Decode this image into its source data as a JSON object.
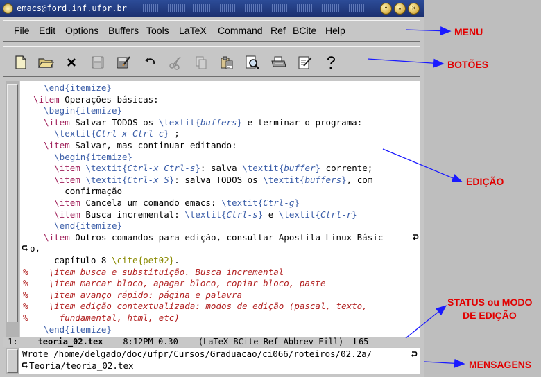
{
  "window": {
    "title": "emacs@ford.inf.ufpr.br",
    "menu": [
      "File",
      "Edit",
      "Options",
      "Buffers",
      "Tools",
      "LaTeX",
      "Command",
      "Ref",
      "BCite",
      "Help"
    ],
    "toolbar_icons": [
      "new-file-icon",
      "open-folder-icon",
      "close-x-icon",
      "save-disk-icon",
      "save-as-icon",
      "undo-icon",
      "cut-scissors-icon",
      "copy-icon",
      "paste-icon",
      "search-icon",
      "print-icon",
      "spell-check-icon",
      "help-question-icon"
    ]
  },
  "editor": {
    "lines": [
      {
        "indent": "    ",
        "tokens": [
          [
            "\\end{itemize}",
            "fn"
          ]
        ]
      },
      {
        "indent": "  ",
        "tokens": [
          [
            "\\item",
            "kw"
          ],
          [
            " Operações básicas:",
            ""
          ]
        ]
      },
      {
        "indent": "    ",
        "tokens": [
          [
            "\\begin{itemize}",
            "fn"
          ]
        ]
      },
      {
        "indent": "    ",
        "tokens": [
          [
            "\\item",
            "kw"
          ],
          [
            " Salvar TODOS os ",
            ""
          ],
          [
            "\\textit{",
            "fn"
          ],
          [
            "buffers",
            "arg"
          ],
          [
            "}",
            "fn"
          ],
          [
            " e terminar o programa:",
            ""
          ]
        ]
      },
      {
        "indent": "      ",
        "tokens": [
          [
            "\\textit{",
            "fn"
          ],
          [
            "Ctrl-x Ctrl-c",
            "arg"
          ],
          [
            "}",
            "fn"
          ],
          [
            " ;",
            ""
          ]
        ]
      },
      {
        "indent": "    ",
        "tokens": [
          [
            "\\item",
            "kw"
          ],
          [
            " Salvar, mas continuar editando:",
            ""
          ]
        ]
      },
      {
        "indent": "      ",
        "tokens": [
          [
            "\\begin{itemize}",
            "fn"
          ]
        ]
      },
      {
        "indent": "      ",
        "tokens": [
          [
            "\\item",
            "kw"
          ],
          [
            " ",
            ""
          ],
          [
            "\\textit{",
            "fn"
          ],
          [
            "Ctrl-x Ctrl-s",
            "arg"
          ],
          [
            "}",
            "fn"
          ],
          [
            ": salva ",
            ""
          ],
          [
            "\\textit{",
            "fn"
          ],
          [
            "buffer",
            "arg"
          ],
          [
            "}",
            "fn"
          ],
          [
            " corrente;",
            ""
          ]
        ]
      },
      {
        "indent": "      ",
        "tokens": [
          [
            "\\item",
            "kw"
          ],
          [
            " ",
            ""
          ],
          [
            "\\textit{",
            "fn"
          ],
          [
            "Ctrl-x S",
            "arg"
          ],
          [
            "}",
            "fn"
          ],
          [
            ": salva TODOS os ",
            ""
          ],
          [
            "\\textit{",
            "fn"
          ],
          [
            "buffers",
            "arg"
          ],
          [
            "}",
            "fn"
          ],
          [
            ", com",
            ""
          ]
        ]
      },
      {
        "indent": "        ",
        "tokens": [
          [
            "confirmação",
            ""
          ]
        ]
      },
      {
        "indent": "      ",
        "tokens": [
          [
            "\\item",
            "kw"
          ],
          [
            " Cancela um comando emacs: ",
            ""
          ],
          [
            "\\textit{",
            "fn"
          ],
          [
            "Ctrl-g",
            "arg"
          ],
          [
            "}",
            "fn"
          ]
        ]
      },
      {
        "indent": "      ",
        "tokens": [
          [
            "\\item",
            "kw"
          ],
          [
            " Busca incremental: ",
            ""
          ],
          [
            "\\textit{",
            "fn"
          ],
          [
            "Ctrl-s",
            "arg"
          ],
          [
            "}",
            "fn"
          ],
          [
            " e ",
            ""
          ],
          [
            "\\textit{",
            "fn"
          ],
          [
            "Ctrl-r",
            "arg"
          ],
          [
            "}",
            "fn"
          ]
        ]
      },
      {
        "indent": "      ",
        "tokens": [
          [
            "\\end{itemize}",
            "fn"
          ]
        ]
      },
      {
        "indent": "    ",
        "tokens": [
          [
            "\\item",
            "kw"
          ],
          [
            " Outros comandos para edição, consultar Apostila Linux Básic",
            ""
          ]
        ],
        "wrap_end": true
      },
      {
        "indent": "",
        "tokens": [
          [
            "o,",
            ""
          ]
        ],
        "wrap_start": true
      },
      {
        "indent": "      ",
        "tokens": [
          [
            "capítulo 8 ",
            ""
          ],
          [
            "\\cite{pet02}",
            "cite"
          ],
          [
            ".",
            ""
          ]
        ]
      },
      {
        "indent": "",
        "tokens": [
          [
            "%    \\item busca e substituição. Busca incremental",
            "cm"
          ]
        ]
      },
      {
        "indent": "",
        "tokens": [
          [
            "%    \\item marcar bloco, apagar bloco, copiar bloco, paste",
            "cm"
          ]
        ]
      },
      {
        "indent": "",
        "tokens": [
          [
            "%    \\item avanço rápido: página e palavra",
            "cm"
          ]
        ]
      },
      {
        "indent": "",
        "tokens": [
          [
            "%    \\item edição contextualizada: modos de edição (pascal, texto,",
            "cm"
          ]
        ]
      },
      {
        "indent": "",
        "tokens": [
          [
            "%      fundamental, html, etc)",
            "cm"
          ]
        ]
      },
      {
        "indent": "    ",
        "tokens": [
          [
            "\\end{itemize}",
            "fn"
          ]
        ]
      }
    ]
  },
  "modeline": {
    "left": "-1:--  ",
    "buffer": "teoria_02.tex",
    "right": "    8:12PM 0.30    (LaTeX BCite Ref Abbrev Fill)--L65--"
  },
  "minibuffer": {
    "line1": "Wrote /home/delgado/doc/ufpr/Cursos/Graduacao/ci066/roteiros/02.2a/",
    "line2": "Teoria/teoria_02.tex"
  },
  "annotations": {
    "menu": "MENU",
    "botoes": "BOTÕES",
    "edicao": "EDIÇÃO",
    "status_line1": "STATUS ou MODO",
    "status_line2": "DE EDIÇÃO",
    "mensagens": "MENSAGENS",
    "color": "#e10000",
    "arrow_color": "#1a1aff"
  }
}
